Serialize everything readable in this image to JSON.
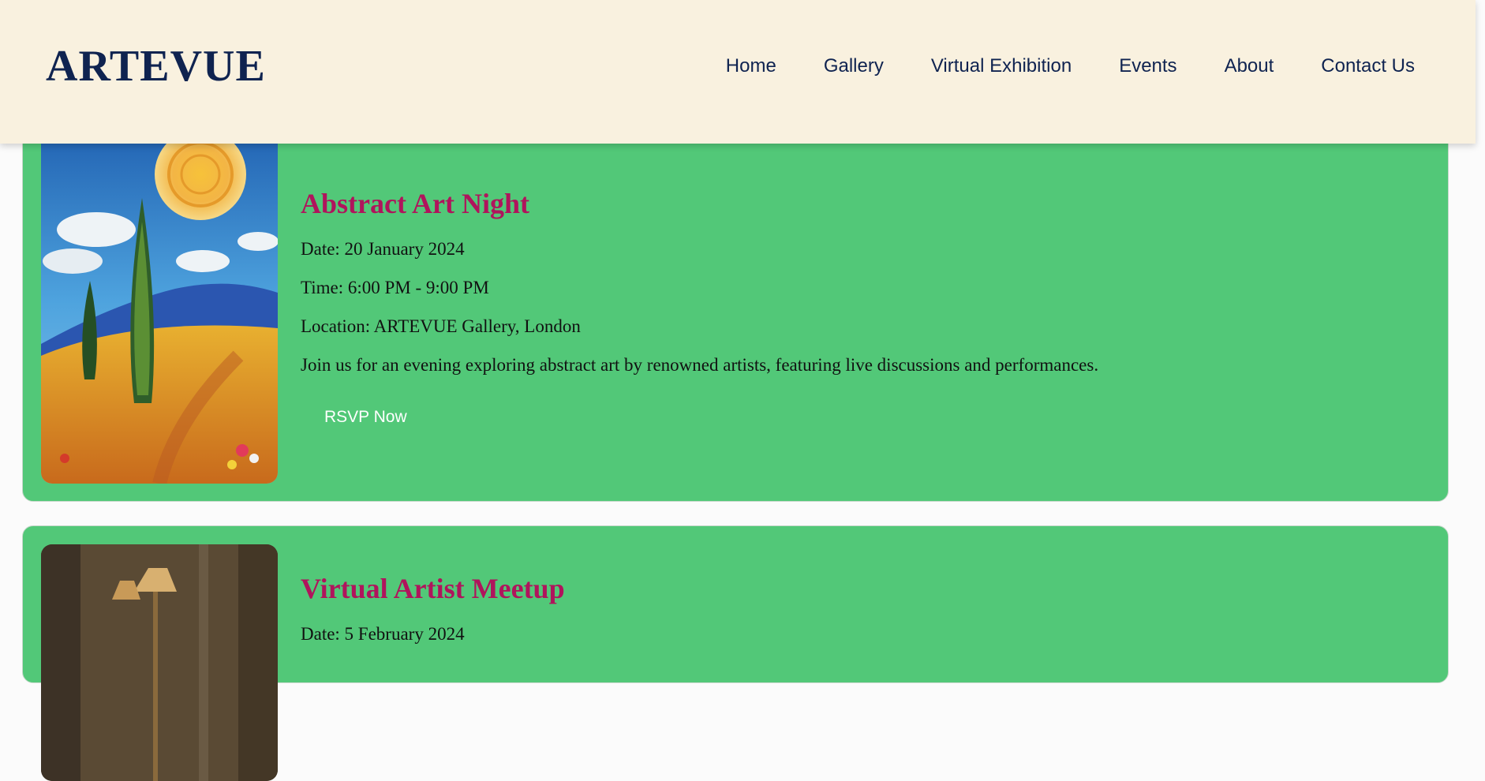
{
  "header": {
    "logo": "ARTEVUE",
    "nav": [
      "Home",
      "Gallery",
      "Virtual Exhibition",
      "Events",
      "About",
      "Contact Us"
    ]
  },
  "events": [
    {
      "title": "Abstract Art Night",
      "date": "Date: 20 January 2024",
      "time": "Time: 6:00 PM - 9:00 PM",
      "location": "Location: ARTEVUE Gallery, London",
      "description": "Join us for an evening exploring abstract art by renowned artists, featuring live discussions and performances.",
      "button": "RSVP Now"
    },
    {
      "title": "Virtual Artist Meetup",
      "date": "Date: 5 February 2024"
    }
  ],
  "colors": {
    "header_bg": "#f9f1df",
    "navy": "#0f2350",
    "card_bg": "#52c878",
    "title": "#b0145c"
  }
}
